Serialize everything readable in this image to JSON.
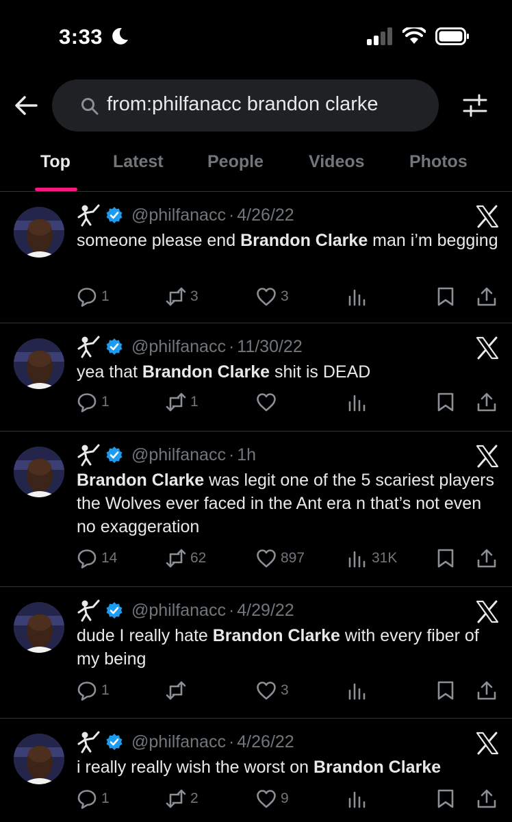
{
  "status_bar": {
    "time": "3:33"
  },
  "search": {
    "query": "from:philfanacc brandon clarke"
  },
  "tabs": [
    "Top",
    "Latest",
    "People",
    "Videos",
    "Photos"
  ],
  "tweets": [
    {
      "handle": "@philfanacc",
      "date": "4/26/22",
      "segments": [
        {
          "t": "someone please end ",
          "b": false
        },
        {
          "t": "Brandon Clarke",
          "b": true
        },
        {
          "t": " man i’m begging",
          "b": false
        }
      ],
      "replies": "1",
      "retweets": "3",
      "likes": "3",
      "views": ""
    },
    {
      "handle": "@philfanacc",
      "date": "11/30/22",
      "segments": [
        {
          "t": "yea that ",
          "b": false
        },
        {
          "t": "Brandon Clarke",
          "b": true
        },
        {
          "t": " shit is DEAD",
          "b": false
        }
      ],
      "replies": "1",
      "retweets": "1",
      "likes": "",
      "views": ""
    },
    {
      "handle": "@philfanacc",
      "date": "1h",
      "segments": [
        {
          "t": "Brandon Clarke",
          "b": true
        },
        {
          "t": " was legit one of the 5 scariest players the Wolves ever faced in the Ant era n that’s not even no exaggeration",
          "b": false
        }
      ],
      "replies": "14",
      "retweets": "62",
      "likes": "897",
      "views": "31K"
    },
    {
      "handle": "@philfanacc",
      "date": "4/29/22",
      "segments": [
        {
          "t": "dude I really hate ",
          "b": false
        },
        {
          "t": "Brandon Clarke",
          "b": true
        },
        {
          "t": " with every fiber of my being",
          "b": false
        }
      ],
      "replies": "1",
      "retweets": "",
      "likes": "3",
      "views": ""
    },
    {
      "handle": "@philfanacc",
      "date": "4/26/22",
      "segments": [
        {
          "t": "i really really wish the worst on ",
          "b": false
        },
        {
          "t": "Brandon Clarke",
          "b": true
        }
      ],
      "replies": "1",
      "retweets": "2",
      "likes": "9",
      "views": ""
    }
  ],
  "icons": [
    "moon-icon",
    "signal-icon",
    "wifi-icon",
    "battery-icon",
    "back-arrow-icon",
    "search-icon",
    "filter-icon",
    "fencer-emoji-icon",
    "verified-badge-icon",
    "x-logo-icon",
    "reply-icon",
    "retweet-icon",
    "like-icon",
    "views-icon",
    "bookmark-icon",
    "share-icon"
  ],
  "colors": {
    "accent": "#f91880",
    "verified": "#1d9bf0",
    "muted": "#71767b",
    "text": "#e7e9ea"
  }
}
